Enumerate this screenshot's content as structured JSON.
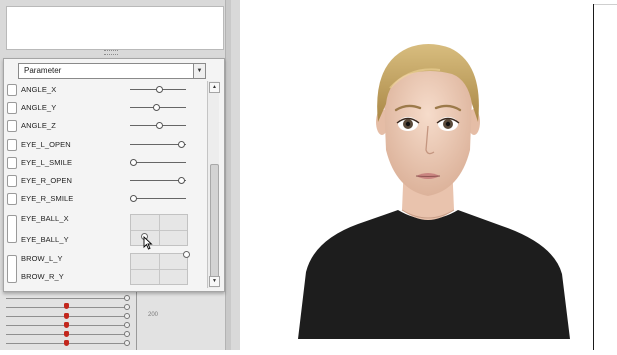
{
  "param_panel": {
    "dropdown_value": "Parameter",
    "params": [
      {
        "label": "ANGLE_X",
        "kind": "slider",
        "value": 0.5
      },
      {
        "label": "ANGLE_Y",
        "kind": "slider",
        "value": 0.45
      },
      {
        "label": "ANGLE_Z",
        "kind": "slider",
        "value": 0.5
      },
      {
        "label": "EYE_L_OPEN",
        "kind": "slider",
        "value": 0.95
      },
      {
        "label": "EYE_L_SMILE",
        "kind": "slider",
        "value": 0.0
      },
      {
        "label": "EYE_R_OPEN",
        "kind": "slider",
        "value": 0.95
      },
      {
        "label": "EYE_R_SMILE",
        "kind": "slider",
        "value": 0.0
      },
      {
        "label": "EYE_BALL_X",
        "kind": "pad"
      },
      {
        "label": "EYE_BALL_Y",
        "kind": "pad"
      },
      {
        "label": "BROW_L_Y",
        "kind": "pad"
      },
      {
        "label": "BROW_R_Y",
        "kind": "pad"
      }
    ]
  },
  "timeline": {
    "ruler_value": "200"
  },
  "colors": {
    "keyframe": "#c2261c",
    "shirt": "#1d1d1d",
    "hair": "#c8a763",
    "skin": "#f1d0bb"
  }
}
